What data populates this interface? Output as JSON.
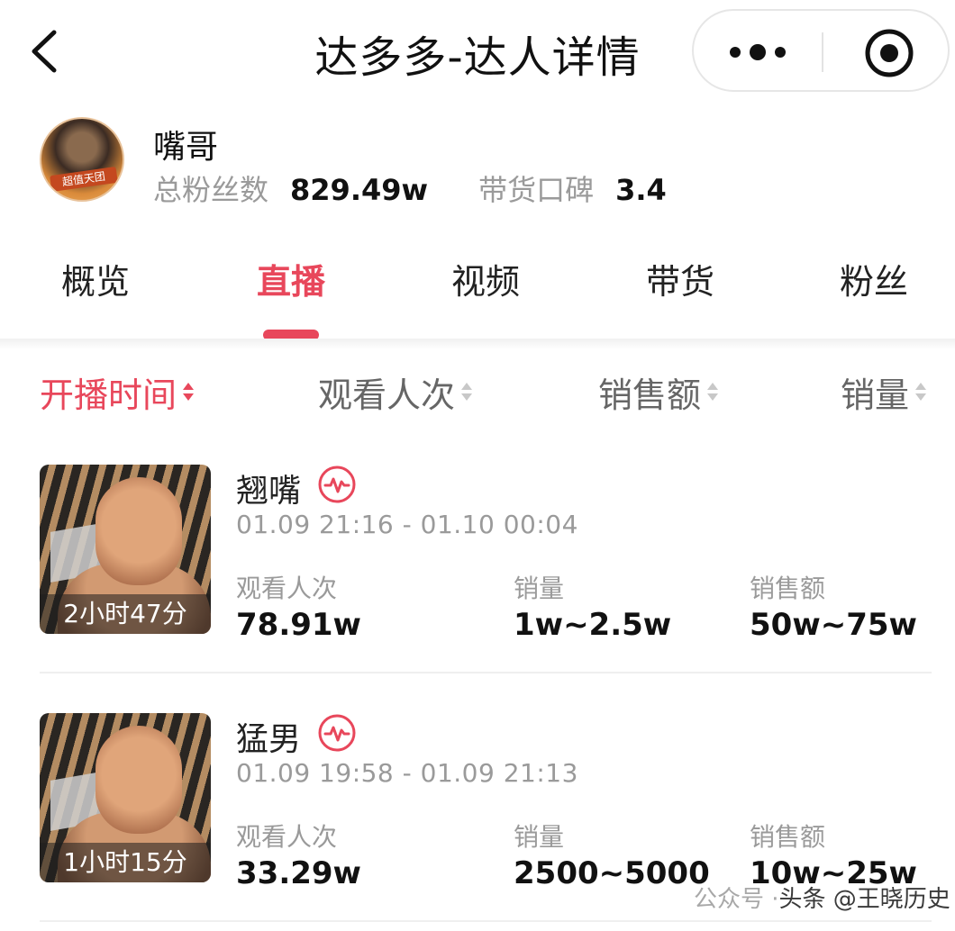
{
  "header": {
    "back_icon": "chevron-left-icon",
    "title": "达多多-达人详情",
    "more_icon": "more-dots-icon",
    "close_icon": "target-icon"
  },
  "profile": {
    "name": "嘴哥",
    "fans_label": "总粉丝数",
    "fans_value": "829.49w",
    "reputation_label": "带货口碑",
    "reputation_value": "3.4"
  },
  "tabs": [
    {
      "label": "概览",
      "active": false
    },
    {
      "label": "直播",
      "active": true
    },
    {
      "label": "视频",
      "active": false
    },
    {
      "label": "带货",
      "active": false
    },
    {
      "label": "粉丝",
      "active": false
    }
  ],
  "sort": [
    {
      "label": "开播时间",
      "active": true
    },
    {
      "label": "观看人次",
      "active": false
    },
    {
      "label": "销售额",
      "active": false
    },
    {
      "label": "销量",
      "active": false
    }
  ],
  "lives": [
    {
      "title": "翘嘴",
      "time": "01.09 21:16 - 01.10 00:04",
      "duration": "2小时47分",
      "views_label": "观看人次",
      "views": "78.91w",
      "sales_label": "销量",
      "sales": "1w~2.5w",
      "revenue_label": "销售额",
      "revenue": "50w~75w"
    },
    {
      "title": "猛男",
      "time": "01.09 19:58 - 01.09 21:13",
      "duration": "1小时15分",
      "views_label": "观看人次",
      "views": "33.29w",
      "sales_label": "销量",
      "sales": "2500~5000",
      "revenue_label": "销售额",
      "revenue": "10w~25w"
    }
  ],
  "watermark": {
    "text": "头条 @王晓历史",
    "faded_text": "公众号 · "
  },
  "colors": {
    "accent": "#e8475b",
    "muted": "#9a9a9a"
  }
}
